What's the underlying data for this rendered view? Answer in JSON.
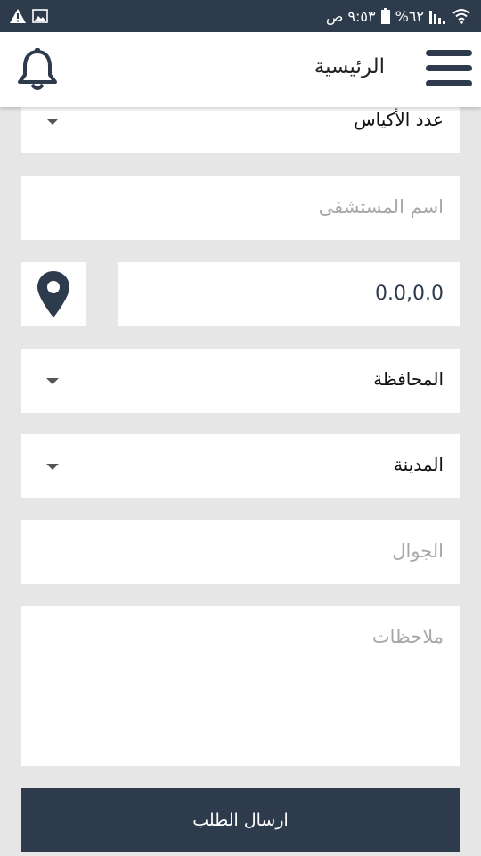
{
  "status_bar": {
    "time": "٩:٥٣ ص",
    "battery": "%٦٢",
    "left_icons": [
      "alert-icon",
      "image-icon"
    ],
    "right_icons": [
      "battery-icon",
      "signal-icon",
      "wifi-icon"
    ]
  },
  "app_bar": {
    "title": "الرئيسية",
    "menu_icon": "hamburger-menu-icon",
    "notification_icon": "bell-icon"
  },
  "form": {
    "bags_count": {
      "label": "عدد الأكياس"
    },
    "hospital_name": {
      "placeholder": "اسم المستشفى"
    },
    "location": {
      "value": "0.0,0.0",
      "icon": "map-pin-icon"
    },
    "governorate": {
      "label": "المحافظة"
    },
    "city": {
      "label": "المدينة"
    },
    "mobile": {
      "placeholder": "الجوال"
    },
    "notes": {
      "placeholder": "ملاحظات"
    },
    "submit_label": "ارسال الطلب"
  },
  "colors": {
    "primary": "#2d3b4d",
    "background": "#e6e6e6",
    "field": "#ffffff",
    "placeholder": "#a8a8a8"
  }
}
